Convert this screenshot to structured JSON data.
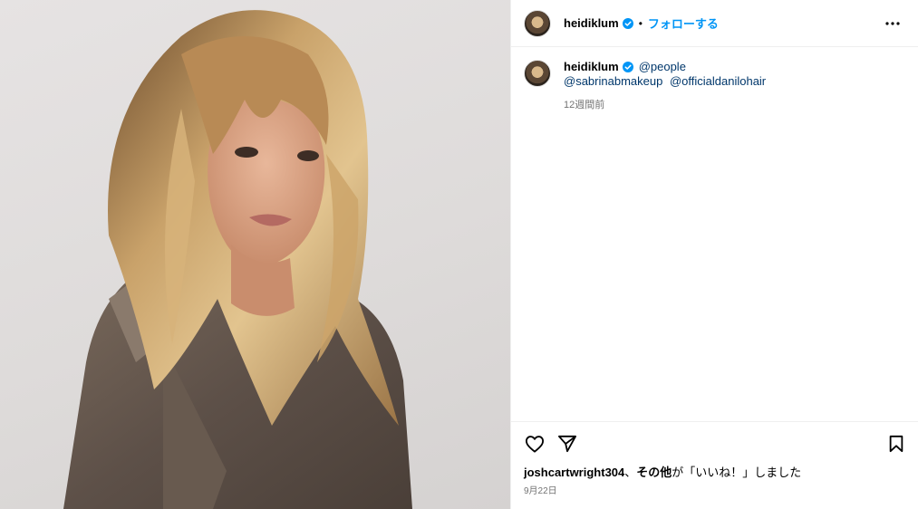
{
  "header": {
    "username": "heidiklum",
    "separator": "•",
    "follow_label": "フォローする",
    "more_icon": "more-horizontal-icon"
  },
  "caption": {
    "username": "heidiklum",
    "mention_1": "@people",
    "mention_2": "@sabrinabmakeup",
    "mention_3": "@officialdanilohair",
    "time": "12週間前"
  },
  "actions": {
    "like_icon": "heart-icon",
    "share_icon": "paper-plane-icon",
    "save_icon": "bookmark-icon"
  },
  "likes": {
    "user": "joshcartwright304",
    "separator": "、",
    "others": "その他",
    "suffix": "が「いいね！」しました"
  },
  "post_date": "9月22日",
  "colors": {
    "accent": "#0095f6",
    "mention": "#00376b",
    "verified": "#0095f6",
    "muted": "#737373",
    "divider": "#efefef"
  }
}
